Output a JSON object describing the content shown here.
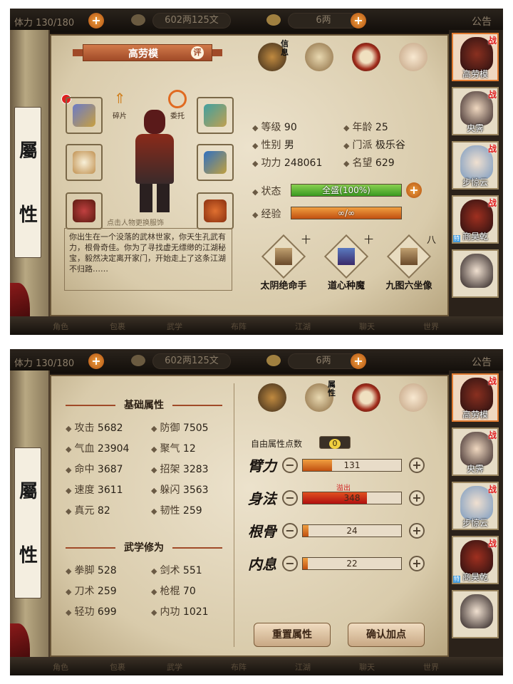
{
  "topbar": {
    "stamina": "体力 130/180",
    "currency": "602两125文",
    "gold": "6两",
    "announcement": "公告"
  },
  "left_tab": {
    "char1": "屬",
    "char2": "性"
  },
  "bottombar": {
    "items": [
      "角色",
      "包裹",
      "武学",
      "布阵",
      "江湖",
      "聊天",
      "世界"
    ]
  },
  "characters": [
    {
      "name": "高劳模",
      "badge": "战"
    },
    {
      "name": "央霁",
      "badge": "战"
    },
    {
      "name": "步惊云",
      "badge": "战"
    },
    {
      "name": "商昊乾",
      "badge": "战"
    },
    {
      "name": "",
      "badge": ""
    }
  ],
  "top_icon_labels": {
    "p1": "信息",
    "p2": "属性"
  },
  "panel1": {
    "hero_name": "高劳模",
    "rate_label": "评",
    "swap_label": "碎片",
    "change_label": "委托",
    "hint": "点击人物更换服饰",
    "stats": [
      {
        "k": "等级",
        "v": "90"
      },
      {
        "k": "年龄",
        "v": "25"
      },
      {
        "k": "性别",
        "v": "男"
      },
      {
        "k": "门派",
        "v": "极乐谷"
      },
      {
        "k": "功力",
        "v": "248061"
      },
      {
        "k": "名望",
        "v": "629"
      }
    ],
    "status_label": "状态",
    "status_value": "全盛(100%)",
    "status_fill": 1.0,
    "exp_label": "经验",
    "exp_value": "∞/∞",
    "exp_fill": 1.0,
    "description": "你出生在一个没落的武林世家，你天生孔武有力，根骨奇佳。你为了寻找虚无缥缈的江湖秘宝，毅然决定离开家门，开始走上了这条江湖不归路……",
    "skills": [
      {
        "name": "太阴绝命手",
        "rank": "十"
      },
      {
        "name": "道心种魔",
        "rank": "十"
      },
      {
        "name": "九图六坐像",
        "rank": "八"
      }
    ]
  },
  "panel2": {
    "basic_title": "基础属性",
    "basic": [
      {
        "k": "攻击",
        "v": "5682"
      },
      {
        "k": "防御",
        "v": "7505"
      },
      {
        "k": "气血",
        "v": "23904"
      },
      {
        "k": "聚气",
        "v": "12"
      },
      {
        "k": "命中",
        "v": "3687"
      },
      {
        "k": "招架",
        "v": "3283"
      },
      {
        "k": "速度",
        "v": "3611"
      },
      {
        "k": "躲闪",
        "v": "3563"
      },
      {
        "k": "真元",
        "v": "82"
      },
      {
        "k": "韧性",
        "v": "259"
      }
    ],
    "martial_title": "武学修为",
    "martial": [
      {
        "k": "拳脚",
        "v": "528"
      },
      {
        "k": "剑术",
        "v": "551"
      },
      {
        "k": "刀术",
        "v": "259"
      },
      {
        "k": "枪棍",
        "v": "70"
      },
      {
        "k": "轻功",
        "v": "699"
      },
      {
        "k": "内功",
        "v": "1021"
      }
    ],
    "free_points_label": "自由属性点数",
    "free_points": "0",
    "attrs": [
      {
        "name": "臂力",
        "value": "131",
        "fill": 0.3,
        "over": ""
      },
      {
        "name": "身法",
        "value": "348",
        "fill": 0.65,
        "over": "溢出"
      },
      {
        "name": "根骨",
        "value": "24",
        "fill": 0.06,
        "over": ""
      },
      {
        "name": "内息",
        "value": "22",
        "fill": 0.05,
        "over": ""
      }
    ],
    "reset_label": "重置属性",
    "confirm_label": "确认加点"
  }
}
